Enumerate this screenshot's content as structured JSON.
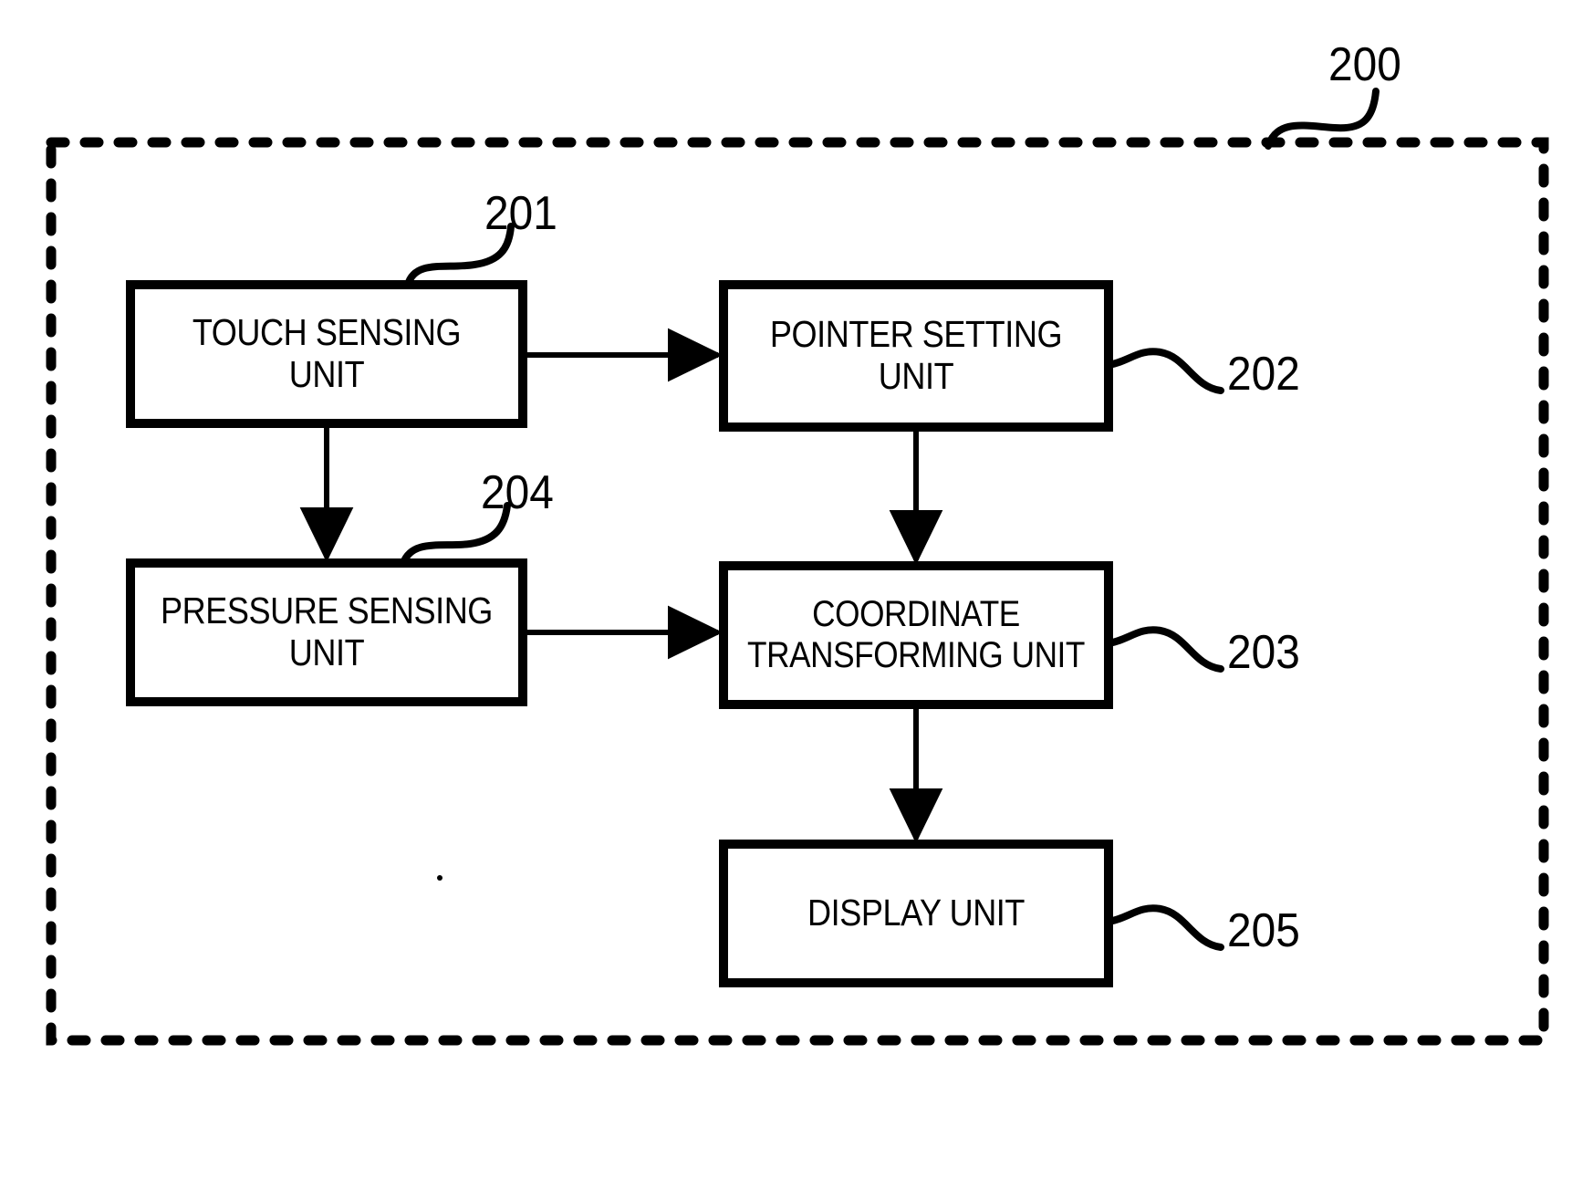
{
  "figure": {
    "type": "patent-block-diagram",
    "system_ref": "200",
    "blocks": [
      {
        "id": "touch",
        "label": "TOUCH SENSING UNIT",
        "ref": "201"
      },
      {
        "id": "pointer",
        "label": "POINTER SETTING\nUNIT",
        "ref": "202"
      },
      {
        "id": "pressure",
        "label": "PRESSURE SENSING\nUNIT",
        "ref": "204"
      },
      {
        "id": "coordinate",
        "label": "COORDINATE\nTRANSFORMING UNIT",
        "ref": "203"
      },
      {
        "id": "display",
        "label": "DISPLAY UNIT",
        "ref": "205"
      }
    ],
    "connections": [
      {
        "from": "touch",
        "to": "pointer",
        "direction": "right"
      },
      {
        "from": "touch",
        "to": "pressure",
        "direction": "down"
      },
      {
        "from": "pointer",
        "to": "coordinate",
        "direction": "down"
      },
      {
        "from": "pressure",
        "to": "coordinate",
        "direction": "right"
      },
      {
        "from": "coordinate",
        "to": "display",
        "direction": "down"
      }
    ],
    "colors": {
      "ink": "#000000",
      "background": "#ffffff"
    }
  }
}
